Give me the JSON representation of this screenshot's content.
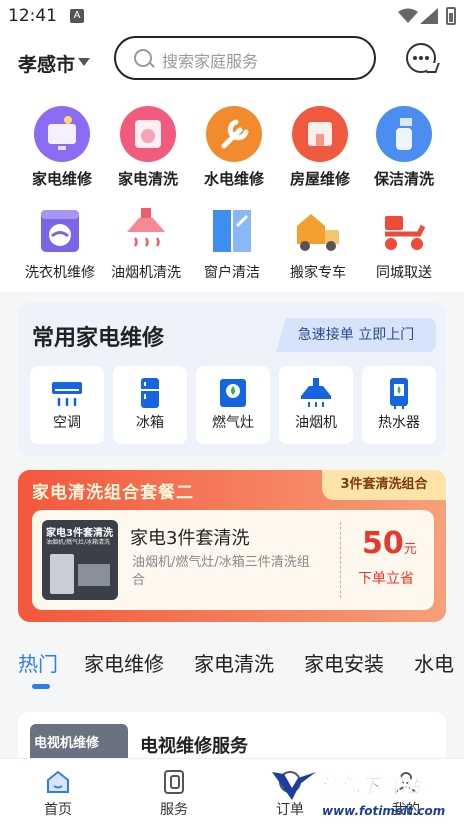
{
  "status": {
    "time": "12:41",
    "notif": "A"
  },
  "header": {
    "city": "孝感市",
    "search_placeholder": "搜索家庭服务"
  },
  "grid": {
    "row1": [
      {
        "label": "家电维修",
        "icon": "tv-repair-icon",
        "color": "#8c6cf2"
      },
      {
        "label": "家电清洗",
        "icon": "washer-clean-icon",
        "color": "#f25a7e"
      },
      {
        "label": "水电维修",
        "icon": "wrench-icon",
        "color": "#f28a2e"
      },
      {
        "label": "房屋维修",
        "icon": "house-repair-icon",
        "color": "#ef5a3e"
      },
      {
        "label": "保洁清洗",
        "icon": "cleaning-bottle-icon",
        "color": "#4b8df0"
      }
    ],
    "row2": [
      {
        "label": "洗衣机维修",
        "icon": "washing-machine-icon",
        "color": "#7b64e8"
      },
      {
        "label": "油烟机清洗",
        "icon": "range-hood-icon",
        "color": "#f05c6c"
      },
      {
        "label": "窗户清洁",
        "icon": "window-icon",
        "color": "#3d8ef0"
      },
      {
        "label": "搬家专车",
        "icon": "moving-truck-icon",
        "color": "#f2a12e"
      },
      {
        "label": "同城取送",
        "icon": "delivery-scooter-icon",
        "color": "#ef4a3a"
      }
    ]
  },
  "common": {
    "title": "常用家电维修",
    "tag": "急速接单 立即上门",
    "items": [
      {
        "label": "空调",
        "icon": "air-conditioner-icon"
      },
      {
        "label": "冰箱",
        "icon": "fridge-icon"
      },
      {
        "label": "燃气灶",
        "icon": "gas-stove-icon"
      },
      {
        "label": "油烟机",
        "icon": "range-hood-icon"
      },
      {
        "label": "热水器",
        "icon": "water-heater-icon"
      }
    ],
    "accent": "#1565e0"
  },
  "promo": {
    "title": "家电清洗组合套餐二",
    "tag": "3件套清洗组合",
    "thumb_title": "家电3件套清洗",
    "thumb_sub": "油烟机/燃气灶/冰箱清洗",
    "name": "家电3件套清洗",
    "desc": "油烟机/燃气灶/冰箱三件清洗组合",
    "price": "50",
    "unit": "元",
    "button": "下单立省"
  },
  "tabs": [
    {
      "label": "热门",
      "active": true
    },
    {
      "label": "家电维修",
      "active": false
    },
    {
      "label": "家电清洗",
      "active": false
    },
    {
      "label": "家电安装",
      "active": false
    },
    {
      "label": "水电",
      "active": false
    }
  ],
  "list": {
    "thumb_text": "电视机维修",
    "title": "电视维修服务"
  },
  "nav": [
    {
      "label": "首页",
      "icon": "home-icon"
    },
    {
      "label": "服务",
      "icon": "service-icon"
    },
    {
      "label": "订单",
      "icon": "order-icon"
    },
    {
      "label": "我的",
      "icon": "profile-icon"
    }
  ],
  "watermark": {
    "title": "清源下载站",
    "url": "www.fotimelt.com"
  }
}
